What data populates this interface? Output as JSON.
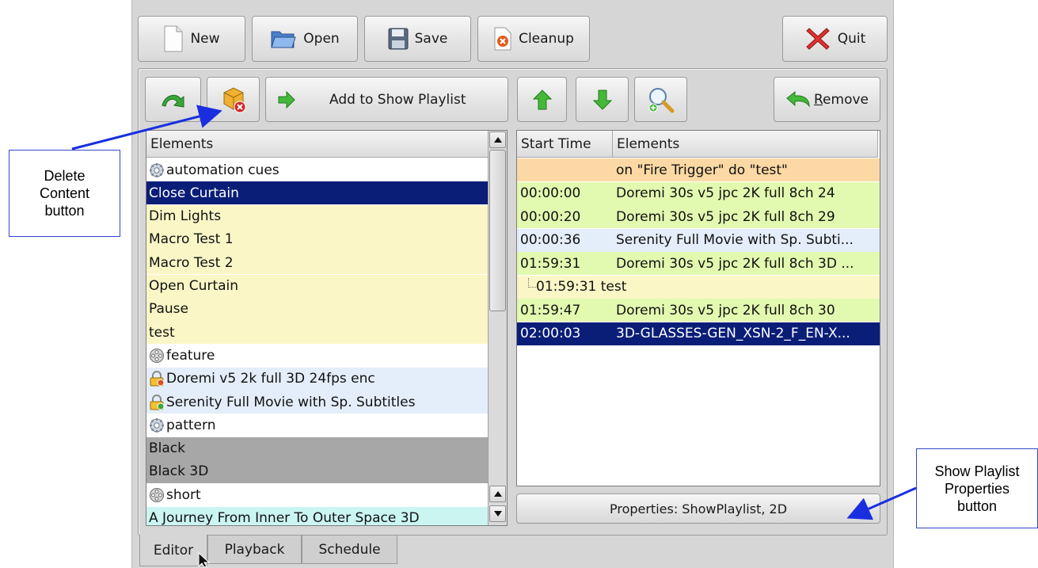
{
  "toolbar": {
    "new": "New",
    "open": "Open",
    "save": "Save",
    "cleanup": "Cleanup",
    "quit": "Quit"
  },
  "editor_toolbar": {
    "add_to_playlist": "Add to Show Playlist",
    "remove": "Remove"
  },
  "elements_list": {
    "header": "Elements",
    "rows": [
      {
        "label": "automation cues",
        "kind": "group",
        "icon": "gear-icon",
        "bg": "white"
      },
      {
        "label": "Close Curtain",
        "kind": "item",
        "bg": "navy",
        "selected": true
      },
      {
        "label": "Dim Lights",
        "kind": "item",
        "bg": "yellow"
      },
      {
        "label": "Macro Test 1",
        "kind": "item",
        "bg": "yellow"
      },
      {
        "label": "Macro Test 2",
        "kind": "item",
        "bg": "yellow"
      },
      {
        "label": "Open Curtain",
        "kind": "item",
        "bg": "yellow"
      },
      {
        "label": "Pause",
        "kind": "item",
        "bg": "yellow"
      },
      {
        "label": "test",
        "kind": "item",
        "bg": "yellow"
      },
      {
        "label": "feature",
        "kind": "group",
        "icon": "film-reel-icon",
        "bg": "white"
      },
      {
        "label": "Doremi v5 2k full 3D 24fps enc",
        "kind": "item",
        "icon": "encrypted-lock-icon",
        "bg": "blue"
      },
      {
        "label": "Serenity Full Movie with Sp. Subtitles",
        "kind": "item",
        "icon": "lock-icon",
        "bg": "blue"
      },
      {
        "label": "pattern",
        "kind": "group",
        "icon": "gear-icon",
        "bg": "white"
      },
      {
        "label": "Black",
        "kind": "item",
        "bg": "gray"
      },
      {
        "label": "Black 3D",
        "kind": "item",
        "bg": "gray"
      },
      {
        "label": "short",
        "kind": "group",
        "icon": "film-reel-icon",
        "bg": "white"
      },
      {
        "label": "A Journey From Inner To Outer Space 3D",
        "kind": "item",
        "bg": "cyan"
      }
    ]
  },
  "playlist": {
    "header_start": "Start Time",
    "header_elements": "Elements",
    "rows": [
      {
        "time": "",
        "label": "on \"Fire Trigger\" do \"test\"",
        "bg": "orange"
      },
      {
        "time": "00:00:00",
        "label": "Doremi 30s v5 jpc 2K full 8ch 24",
        "bg": "green"
      },
      {
        "time": "00:00:20",
        "label": "Doremi 30s v5 jpc 2K full 8ch 29",
        "bg": "green"
      },
      {
        "time": "00:00:36",
        "label": "Serenity Full Movie with Sp. Subti...",
        "bg": "blue"
      },
      {
        "time": "01:59:31",
        "label": "Doremi 30s v5 jpc 2K full 8ch 3D ...",
        "bg": "green"
      },
      {
        "time": "01:59:31",
        "label": "test",
        "bg": "lightyellow",
        "child": true
      },
      {
        "time": "01:59:47",
        "label": "Doremi 30s v5 jpc 2K full 8ch 30",
        "bg": "green"
      },
      {
        "time": "02:00:03",
        "label": "3D-GLASSES-GEN_XSN-2_F_EN-X...",
        "bg": "navy",
        "selected": true
      }
    ]
  },
  "properties_button": "Properties: ShowPlaylist, 2D",
  "tabs": [
    "Editor",
    "Playback",
    "Schedule"
  ],
  "callouts": {
    "delete_content": "Delete\nContent\nbutton",
    "show_playlist_properties": "Show Playlist\nProperties\nbutton"
  },
  "colors": {
    "selection": "#0a1e78",
    "macro_row": "#fbf6c6",
    "feature_row": "#e4eefa",
    "pattern_row": "#a7a7a7",
    "short_row": "#cbf5f1",
    "clip_row": "#e2fab0",
    "trigger_row": "#fcd9a4",
    "callout_arrow": "#1a2ee0"
  }
}
